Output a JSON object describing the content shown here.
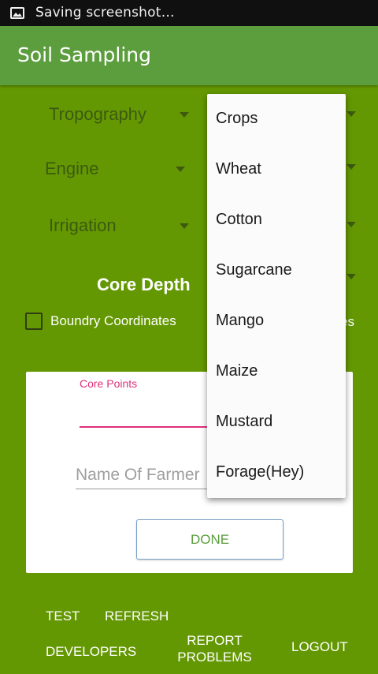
{
  "status_bar": {
    "text": "Saving screenshot…",
    "icon": "image-icon"
  },
  "app_bar": {
    "title": "Soil Sampling"
  },
  "spinners": {
    "tropography": "Tropography",
    "engine": "Engine",
    "irrigation": "Irrigation"
  },
  "core_depth": {
    "label": "Core Depth"
  },
  "boundary": {
    "label": "Boundry Coordinates"
  },
  "partial_checkbox_label": "es",
  "form": {
    "core_points_label": "Core Points",
    "farmer_name_placeholder": "Name Of Farmer",
    "done_label": "DONE"
  },
  "bottom_buttons": {
    "test": "TEST",
    "refresh": "REFRESH",
    "developers": "DEVELOPERS",
    "report_line1": "REPORT",
    "report_line2": "PROBLEMS",
    "logout": "LOGOUT"
  },
  "crops_dropdown": {
    "items": [
      "Crops",
      "Wheat",
      "Cotton",
      "Sugarcane",
      "Mango",
      "Maize",
      "Mustard",
      "Forage(Hey)"
    ]
  },
  "colors": {
    "background": "#649802",
    "app_bar": "#5c9d3e",
    "accent_pink": "#e0307a",
    "spinner_text": "#3d5a10"
  }
}
